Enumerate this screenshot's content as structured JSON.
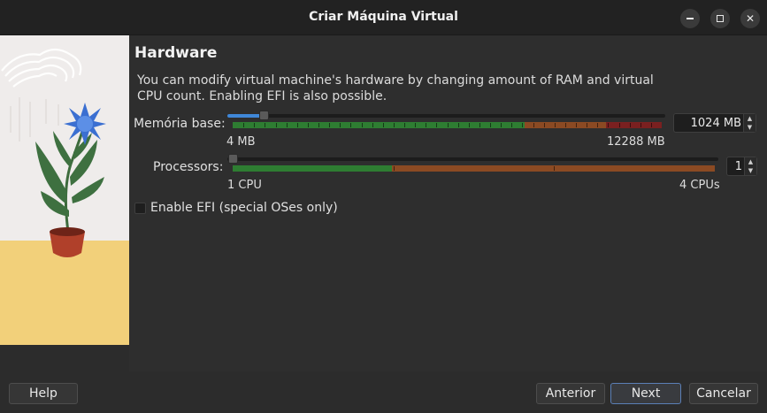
{
  "window": {
    "title": "Criar Máquina Virtual",
    "controls": [
      "minimize-icon",
      "maximize-icon",
      "close-icon"
    ]
  },
  "page": {
    "heading": "Hardware",
    "description": "You can modify virtual machine's hardware by changing amount of RAM and virtual CPU count. Enabling EFI is also possible."
  },
  "memory": {
    "label": "Memória base:",
    "value": "1024 MB",
    "min_label": "4 MB",
    "max_label": "12288 MB",
    "level": 0.083
  },
  "processors": {
    "label": "Processors:",
    "value": "1",
    "min_label": "1 CPU",
    "max_label": "4 CPUs",
    "level": 0
  },
  "efi": {
    "label": "Enable EFI (special OSes only)",
    "checked": false
  },
  "buttons": {
    "help": "Help",
    "back": "Anterior",
    "next": "Next",
    "cancel": "Cancelar"
  },
  "colors": {
    "accent": "#3f87d8",
    "band_green": "#2e7d32",
    "band_orange": "#8b4a23",
    "band_red": "#7a2020",
    "sand": "#f2d07a",
    "flower_blue": "#3b6fd1"
  }
}
